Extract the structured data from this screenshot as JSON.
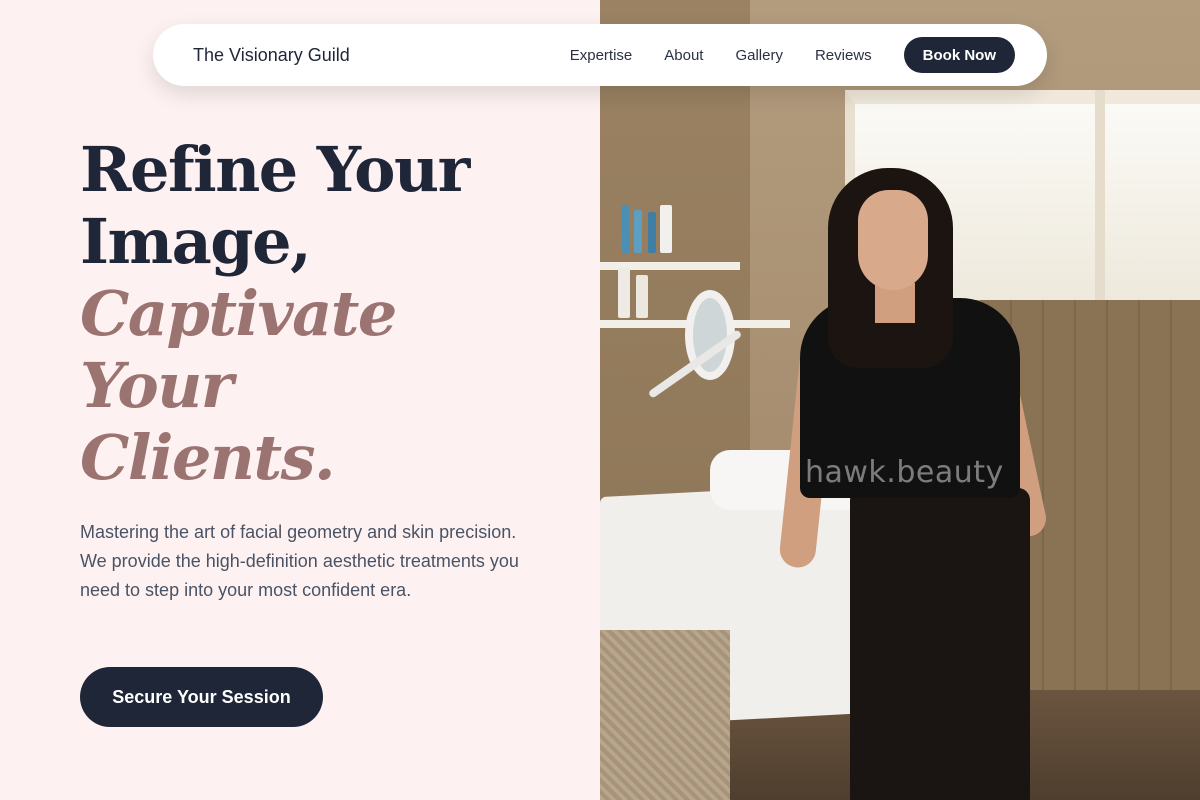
{
  "nav": {
    "brand": "The Visionary Guild",
    "links": [
      "Expertise",
      "About",
      "Gallery",
      "Reviews"
    ],
    "book_label": "Book Now"
  },
  "hero": {
    "headline_dark": [
      "Refine Your",
      "Image,"
    ],
    "headline_accent": [
      "Captivate",
      "Your",
      "Clients."
    ],
    "subtext": "Mastering the art of facial geometry and skin precision. We provide the high-definition aesthetic treatments you need to step into your most confident era.",
    "cta_label": "Secure Your Session"
  },
  "photo": {
    "watermark": "hawk.beauty"
  },
  "colors": {
    "background": "#fdf2f1",
    "navy": "#1e2638",
    "accent": "#9b7371"
  }
}
